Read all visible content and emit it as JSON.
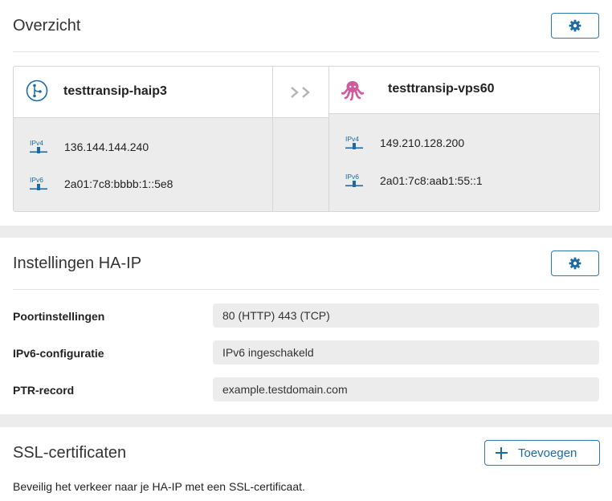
{
  "overview": {
    "title": "Overzicht",
    "haip": {
      "name": "testtransip-haip3",
      "ipv4_label": "IPv4",
      "ipv4": "136.144.144.240",
      "ipv6_label": "IPv6",
      "ipv6": "2a01:7c8:bbbb:1::5e8"
    },
    "vps": {
      "name": "testtransip-vps60",
      "ipv4_label": "IPv4",
      "ipv4": "149.210.128.200",
      "ipv6_label": "IPv6",
      "ipv6": "2a01:7c8:aab1:55::1"
    }
  },
  "settings": {
    "title": "Instellingen HA-IP",
    "rows": [
      {
        "label": "Poortinstellingen",
        "value": "80 (HTTP) 443 (TCP)"
      },
      {
        "label": "IPv6-configuratie",
        "value": "IPv6 ingeschakeld"
      },
      {
        "label": "PTR-record",
        "value": "example.testdomain.com"
      }
    ]
  },
  "ssl": {
    "title": "SSL-certificaten",
    "add_label": "Toevoegen",
    "description": "Beveilig het verkeer naar je HA-IP met een SSL-certificaat."
  },
  "colors": {
    "accent": "#1a6aa5",
    "octopus": "#d05a9c",
    "panel_bg": "#ececec"
  }
}
